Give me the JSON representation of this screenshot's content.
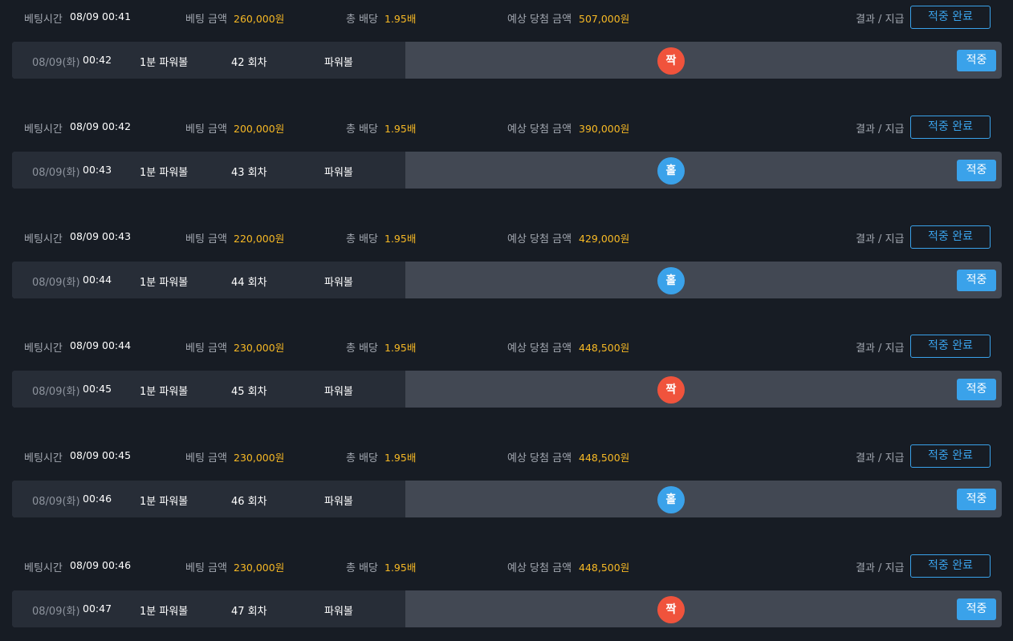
{
  "labels": {
    "bet_time": "베팅시간",
    "bet_amount": "베팅 금액",
    "total_odds": "총 배당",
    "expected_win": "예상 당첨 금액",
    "result_payout": "결과 / 지급"
  },
  "colors": {
    "background": "#171c24",
    "gold": "#f7b924",
    "accent_blue": "#3aa2ea",
    "pick_red": "#f0533c",
    "pick_blue": "#3aa2ea"
  },
  "bets": [
    {
      "bet_time": "08/09 00:41",
      "amount": "260,000원",
      "odds": "1.95배",
      "expected": "507,000원",
      "status": "적중 완료",
      "date": "08/09(화)",
      "time": "00:42",
      "game": "1분 파워볼",
      "round": "42 회차",
      "type": "파워볼",
      "pick": "짝",
      "pick_color": "red",
      "result": "적중"
    },
    {
      "bet_time": "08/09 00:42",
      "amount": "200,000원",
      "odds": "1.95배",
      "expected": "390,000원",
      "status": "적중 완료",
      "date": "08/09(화)",
      "time": "00:43",
      "game": "1분 파워볼",
      "round": "43 회차",
      "type": "파워볼",
      "pick": "홀",
      "pick_color": "blue",
      "result": "적중"
    },
    {
      "bet_time": "08/09 00:43",
      "amount": "220,000원",
      "odds": "1.95배",
      "expected": "429,000원",
      "status": "적중 완료",
      "date": "08/09(화)",
      "time": "00:44",
      "game": "1분 파워볼",
      "round": "44 회차",
      "type": "파워볼",
      "pick": "홀",
      "pick_color": "blue",
      "result": "적중"
    },
    {
      "bet_time": "08/09 00:44",
      "amount": "230,000원",
      "odds": "1.95배",
      "expected": "448,500원",
      "status": "적중 완료",
      "date": "08/09(화)",
      "time": "00:45",
      "game": "1분 파워볼",
      "round": "45 회차",
      "type": "파워볼",
      "pick": "짝",
      "pick_color": "red",
      "result": "적중"
    },
    {
      "bet_time": "08/09 00:45",
      "amount": "230,000원",
      "odds": "1.95배",
      "expected": "448,500원",
      "status": "적중 완료",
      "date": "08/09(화)",
      "time": "00:46",
      "game": "1분 파워볼",
      "round": "46 회차",
      "type": "파워볼",
      "pick": "홀",
      "pick_color": "blue",
      "result": "적중"
    },
    {
      "bet_time": "08/09 00:46",
      "amount": "230,000원",
      "odds": "1.95배",
      "expected": "448,500원",
      "status": "적중 완료",
      "date": "08/09(화)",
      "time": "00:47",
      "game": "1분 파워볼",
      "round": "47 회차",
      "type": "파워볼",
      "pick": "짝",
      "pick_color": "red",
      "result": "적중"
    }
  ]
}
